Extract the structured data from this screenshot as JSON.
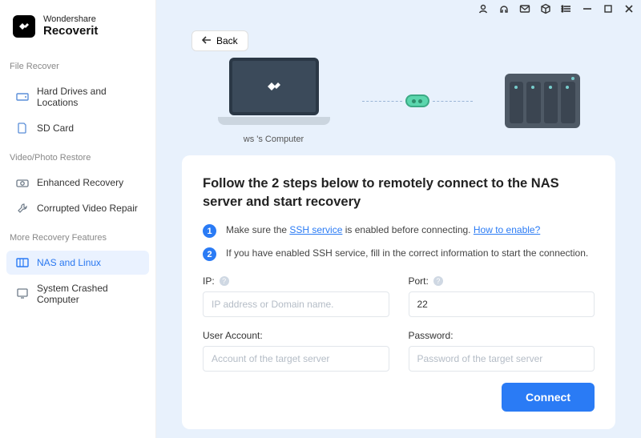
{
  "brand": {
    "line1": "Wondershare",
    "line2": "Recoverit"
  },
  "sidebar": {
    "sections": [
      {
        "title": "File Recover",
        "items": [
          {
            "label": "Hard Drives and Locations",
            "icon": "drive-icon"
          },
          {
            "label": "SD Card",
            "icon": "sdcard-icon"
          }
        ]
      },
      {
        "title": "Video/Photo Restore",
        "items": [
          {
            "label": "Enhanced Recovery",
            "icon": "camera-icon"
          },
          {
            "label": "Corrupted Video Repair",
            "icon": "wrench-icon"
          }
        ]
      },
      {
        "title": "More Recovery Features",
        "items": [
          {
            "label": "NAS and Linux",
            "icon": "nas-icon",
            "active": true
          },
          {
            "label": "System Crashed Computer",
            "icon": "monitor-icon"
          }
        ]
      }
    ]
  },
  "back_label": "Back",
  "computer_label": "ws 's Computer",
  "heading": "Follow the 2 steps below to remotely connect to the NAS server and start recovery",
  "steps": {
    "s1_a": "Make sure the ",
    "s1_link1": "SSH service",
    "s1_b": " is enabled before connecting. ",
    "s1_link2": "How to enable?",
    "s2": "If you have enabled SSH service, fill in the correct information to start the connection."
  },
  "form": {
    "ip_label": "IP:",
    "ip_placeholder": "IP address or Domain name.",
    "ip_value": "",
    "port_label": "Port:",
    "port_value": "22",
    "user_label": "User Account:",
    "user_placeholder": "Account of the target server",
    "user_value": "",
    "pass_label": "Password:",
    "pass_placeholder": "Password of the target server",
    "pass_value": ""
  },
  "connect_label": "Connect"
}
